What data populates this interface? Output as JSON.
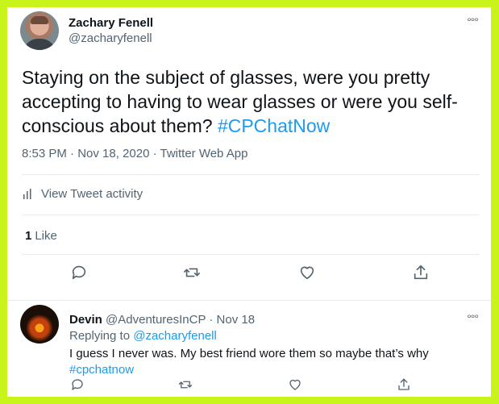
{
  "main_tweet": {
    "display_name": "Zachary Fenell",
    "handle": "@zacharyfenell",
    "more_icon": "more-horizontal-icon",
    "text_before_hashtag": "Staying on the subject of glasses, were you pretty accepting to having to wear glasses or were you self-conscious about them? ",
    "hashtag": "#CPChatNow",
    "timestamp": "8:53 PM · Nov 18, 2020 · Twitter Web App",
    "activity_label": "View Tweet activity",
    "like_count": "1",
    "like_label": "Like",
    "actions": [
      "reply-icon",
      "retweet-icon",
      "like-icon",
      "share-icon"
    ]
  },
  "reply": {
    "display_name": "Devin",
    "handle_and_time": "@AdventuresInCP · Nov 18",
    "replying_prefix": "Replying to",
    "replying_to": "@zacharyfenell",
    "text_line1": "I guess I never was. My best friend wore them so maybe that’s why",
    "hashtag": "#cpchatnow",
    "actions": [
      "reply-icon",
      "retweet-icon",
      "like-icon",
      "share-icon"
    ]
  },
  "colors": {
    "border": "#c8f41c",
    "link": "#1d9bf0",
    "text": "#0f1419",
    "secondary": "#536471"
  }
}
